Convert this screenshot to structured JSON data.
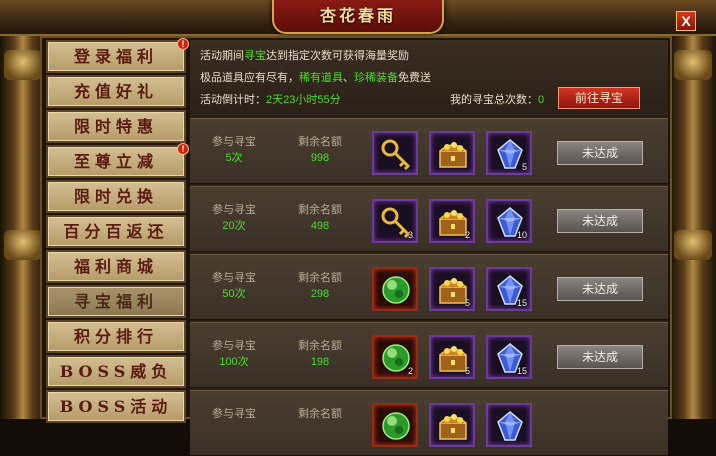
{
  "window": {
    "title": "杏花春雨",
    "close_label": "X"
  },
  "sidebar": {
    "items": [
      {
        "label": "登录福利",
        "badge": "!"
      },
      {
        "label": "充值好礼",
        "badge": ""
      },
      {
        "label": "限时特惠",
        "badge": ""
      },
      {
        "label": "至尊立减",
        "badge": "!"
      },
      {
        "label": "限时兑换",
        "badge": ""
      },
      {
        "label": "百分百返还",
        "badge": ""
      },
      {
        "label": "福利商城",
        "badge": ""
      },
      {
        "label": "寻宝福利",
        "badge": ""
      },
      {
        "label": "积分排行",
        "badge": ""
      },
      {
        "label": "BOSS威负",
        "badge": ""
      },
      {
        "label": "BOSS活动",
        "badge": ""
      }
    ],
    "active_index": 7
  },
  "info": {
    "line1_pre": "活动期间",
    "line1_hl": "寻宝",
    "line1_post": "达到指定次数可获得海量奖励",
    "line2_pre": "极品道具应有尽有，",
    "line2_hl1": "稀有道具",
    "line2_sep": "、",
    "line2_hl2": "珍稀装备",
    "line2_post": "免费送",
    "countdown_label": "活动倒计时：",
    "countdown_value": "2天23小时55分",
    "total_label": "我的寻宝总次数：",
    "total_value": "0",
    "goto_label": "前往寻宝"
  },
  "rows": [
    {
      "req_label": "参与寻宝",
      "req_value": "5次",
      "remain_label": "剩余名额",
      "remain_value": "998",
      "items": [
        {
          "icon": "golden-key-icon",
          "qty": "",
          "frame": "purple"
        },
        {
          "icon": "treasure-chest-icon",
          "qty": "",
          "frame": "purple"
        },
        {
          "icon": "blue-gem-icon",
          "qty": "5",
          "frame": "purple"
        }
      ],
      "status": "未达成"
    },
    {
      "req_label": "参与寻宝",
      "req_value": "20次",
      "remain_label": "剩余名额",
      "remain_value": "498",
      "items": [
        {
          "icon": "golden-key-icon",
          "qty": "3",
          "frame": "purple"
        },
        {
          "icon": "treasure-chest-icon",
          "qty": "2",
          "frame": "purple"
        },
        {
          "icon": "blue-gem-icon",
          "qty": "10",
          "frame": "purple"
        }
      ],
      "status": "未达成"
    },
    {
      "req_label": "参与寻宝",
      "req_value": "50次",
      "remain_label": "剩余名额",
      "remain_value": "298",
      "items": [
        {
          "icon": "green-orb-icon",
          "qty": "",
          "frame": "red"
        },
        {
          "icon": "treasure-chest-icon",
          "qty": "5",
          "frame": "purple"
        },
        {
          "icon": "blue-gem-icon",
          "qty": "15",
          "frame": "purple"
        }
      ],
      "status": "未达成"
    },
    {
      "req_label": "参与寻宝",
      "req_value": "100次",
      "remain_label": "剩余名额",
      "remain_value": "198",
      "items": [
        {
          "icon": "green-orb-icon",
          "qty": "2",
          "frame": "red"
        },
        {
          "icon": "treasure-chest-icon",
          "qty": "5",
          "frame": "purple"
        },
        {
          "icon": "blue-gem-icon",
          "qty": "15",
          "frame": "purple"
        }
      ],
      "status": "未达成"
    },
    {
      "req_label": "参与寻宝",
      "req_value": "",
      "remain_label": "剩余名额",
      "remain_value": "",
      "items": [
        {
          "icon": "green-orb-icon",
          "qty": "",
          "frame": "red"
        },
        {
          "icon": "treasure-chest-icon",
          "qty": "",
          "frame": "purple"
        },
        {
          "icon": "blue-gem-icon",
          "qty": "",
          "frame": "purple"
        }
      ],
      "status": ""
    }
  ],
  "colors": {
    "highlight_green": "#4cdc2a",
    "highlight_red": "#ff4a3a",
    "button_red": "#d43424",
    "frame_gold": "#d2a44c"
  }
}
